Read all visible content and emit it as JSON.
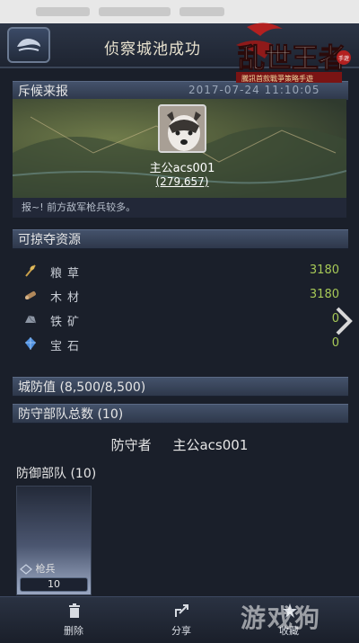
{
  "header": {
    "title": "侦察城池成功"
  },
  "logo": {
    "text": "乱世王者",
    "sub": "騰訊首款戰爭策略手遊",
    "badge": "手遊"
  },
  "scout": {
    "section_title": "斥候来报",
    "date": "2017-07-24   11:10:05",
    "player_name": "主公acs001",
    "player_power": "(279,657)",
    "report": "报~! 前方敌军枪兵较多。"
  },
  "resources": {
    "section_title": "可掠夺资源",
    "items": [
      {
        "label": "粮草",
        "value": "3180",
        "icon": "grain-icon"
      },
      {
        "label": "木材",
        "value": "3180",
        "icon": "wood-icon"
      },
      {
        "label": "铁矿",
        "value": "0",
        "icon": "iron-icon"
      },
      {
        "label": "宝石",
        "value": "0",
        "icon": "gem-icon"
      }
    ]
  },
  "city_defense": {
    "label": "城防值 (8,500/8,500)"
  },
  "defense_total": {
    "label": "防守部队总数 (10)",
    "defender_label": "防守者",
    "defender_name": "主公acs001"
  },
  "troops": {
    "label": "防御部队 (10)",
    "items": [
      {
        "name": "枪兵",
        "count": "10"
      }
    ]
  },
  "bottom": {
    "delete": "删除",
    "share": "分享",
    "favorite": "收藏"
  },
  "watermark": "游戏狗",
  "colors": {
    "accent_value": "#a7c957",
    "bar": "#44526b",
    "background": "#1a1f2a"
  }
}
